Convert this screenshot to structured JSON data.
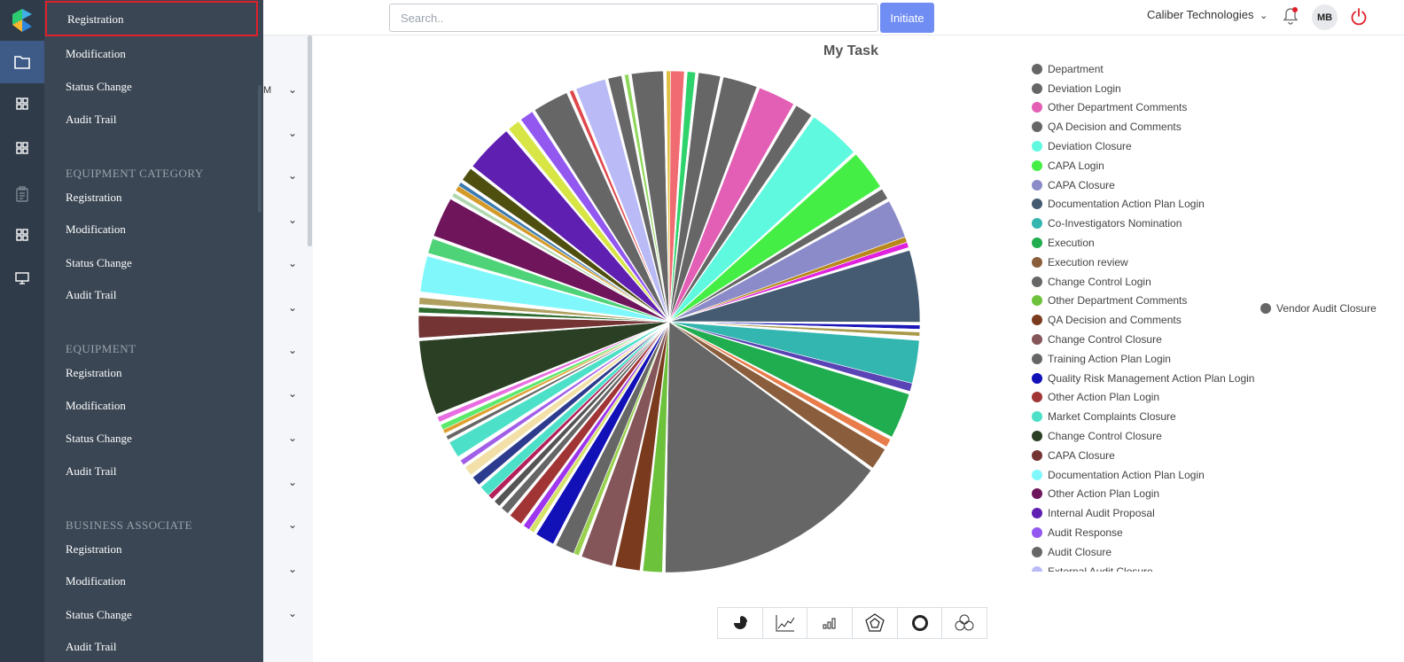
{
  "sidebar": {
    "top_items": [
      {
        "label": "Registration"
      },
      {
        "label": "Modification"
      },
      {
        "label": "Status  Change"
      },
      {
        "label": "Audit  Trail"
      }
    ],
    "sections": [
      {
        "title": "EQUIPMENT  CATEGORY",
        "items": [
          {
            "label": "Registration"
          },
          {
            "label": "Modification"
          },
          {
            "label": "Status  Change"
          },
          {
            "label": "Audit  Trail"
          }
        ]
      },
      {
        "title": "EQUIPMENT",
        "items": [
          {
            "label": "Registration"
          },
          {
            "label": "Modification"
          },
          {
            "label": "Status  Change"
          },
          {
            "label": "Audit  Trail"
          }
        ]
      },
      {
        "title": "BUSINESS  ASSOCIATE",
        "items": [
          {
            "label": "Registration"
          },
          {
            "label": "Modification"
          },
          {
            "label": "Status  Change"
          },
          {
            "label": "Audit  Trail"
          }
        ]
      }
    ]
  },
  "strip": {
    "partial_text": "M"
  },
  "header": {
    "search_placeholder": "Search..",
    "initiate_label": "Initiate",
    "company": "Caliber Technologies",
    "avatar_initials": "MB"
  },
  "colors": {
    "accent": "#6f8df3",
    "rail": "#2f3b48",
    "panel": "#3a4654",
    "power": "#e0202a"
  },
  "chart_data": {
    "type": "pie",
    "title": "My Task",
    "legend_visible": [
      {
        "name": "Department",
        "color": "#666666"
      },
      {
        "name": "Deviation Login",
        "color": "#666666"
      },
      {
        "name": "Other Department Comments",
        "color": "#e35eb5"
      },
      {
        "name": "QA Decision and Comments",
        "color": "#666666"
      },
      {
        "name": "Deviation Closure",
        "color": "#5ff9e0"
      },
      {
        "name": "CAPA Login",
        "color": "#45ee45"
      },
      {
        "name": "CAPA Closure",
        "color": "#8b8bc9"
      },
      {
        "name": "Documentation Action Plan Login",
        "color": "#445b72"
      },
      {
        "name": "Co-Investigators Nomination",
        "color": "#33b6b0"
      },
      {
        "name": "Execution",
        "color": "#1fad4f"
      },
      {
        "name": "Execution review",
        "color": "#8a5e3c"
      },
      {
        "name": "Change Control Login",
        "color": "#666666"
      },
      {
        "name": "Other Department Comments",
        "color": "#6cc23a"
      },
      {
        "name": "QA Decision and Comments",
        "color": "#7a3a1d"
      },
      {
        "name": "Change Control Closure",
        "color": "#845559"
      },
      {
        "name": "Training Action Plan Login",
        "color": "#666666"
      },
      {
        "name": "Quality Risk Management Action Plan Login",
        "color": "#1210b7"
      },
      {
        "name": "Other Action Plan Login",
        "color": "#a13535"
      },
      {
        "name": "Market Complaints Closure",
        "color": "#4de0c8"
      },
      {
        "name": "Change Control Closure",
        "color": "#2a3f23"
      },
      {
        "name": "CAPA Closure",
        "color": "#753434"
      },
      {
        "name": "Documentation Action Plan Login",
        "color": "#80f8fb"
      },
      {
        "name": "Other Action Plan Login",
        "color": "#6e155c"
      },
      {
        "name": "Internal Audit Proposal",
        "color": "#5f1fb0"
      },
      {
        "name": "Audit Response",
        "color": "#9258ef"
      },
      {
        "name": "Audit Closure",
        "color": "#666666"
      },
      {
        "name": "External Audit Closure",
        "color": "#b9baf6"
      }
    ],
    "legend_page2": [
      {
        "name": "Vendor Audit Closure",
        "color": "#666666"
      }
    ],
    "slices": [
      {
        "color": "#f16b72",
        "value": 1.0
      },
      {
        "color": "#ffffff",
        "value": 0.2
      },
      {
        "color": "#2fd36b",
        "value": 0.6
      },
      {
        "color": "#ffffff",
        "value": 0.2
      },
      {
        "color": "#666666",
        "value": 1.6
      },
      {
        "color": "#ffffff",
        "value": 0.2
      },
      {
        "color": "#666666",
        "value": 2.5
      },
      {
        "color": "#ffffff",
        "value": 0.2
      },
      {
        "color": "#e35eb5",
        "value": 2.7
      },
      {
        "color": "#ffffff",
        "value": 0.2
      },
      {
        "color": "#666666",
        "value": 1.3
      },
      {
        "color": "#ffffff",
        "value": 0.2
      },
      {
        "color": "#5ff9e0",
        "value": 3.8
      },
      {
        "color": "#ffffff",
        "value": 0.2
      },
      {
        "color": "#45ee45",
        "value": 2.9
      },
      {
        "color": "#ffffff",
        "value": 0.2
      },
      {
        "color": "#666666",
        "value": 0.8
      },
      {
        "color": "#ffffff",
        "value": 0.2
      },
      {
        "color": "#8b8bc9",
        "value": 2.8
      },
      {
        "color": "#b8891a",
        "value": 0.4
      },
      {
        "color": "#e021e0",
        "value": 0.4
      },
      {
        "color": "#ffffff",
        "value": 0.2
      },
      {
        "color": "#445b72",
        "value": 5.2
      },
      {
        "color": "#ffffff",
        "value": 0.2
      },
      {
        "color": "#1a16b8",
        "value": 0.3
      },
      {
        "color": "#ffffff",
        "value": 0.2
      },
      {
        "color": "#a99a4a",
        "value": 0.3
      },
      {
        "color": "#ffffff",
        "value": 0.3
      },
      {
        "color": "#33b6b0",
        "value": 3.1
      },
      {
        "color": "#5a43b5",
        "value": 0.6
      },
      {
        "color": "#ffffff",
        "value": 0.2
      },
      {
        "color": "#1fad4f",
        "value": 3.3
      },
      {
        "color": "#ffffff",
        "value": 0.2
      },
      {
        "color": "#e87c4a",
        "value": 0.6
      },
      {
        "color": "#ffffff",
        "value": 0.2
      },
      {
        "color": "#8a5e3c",
        "value": 1.6
      },
      {
        "color": "#ffffff",
        "value": 0.2
      },
      {
        "color": "#666666",
        "value": 17.0
      },
      {
        "color": "#ffffff",
        "value": 0.2
      },
      {
        "color": "#6cc23a",
        "value": 1.4
      },
      {
        "color": "#ffffff",
        "value": 0.2
      },
      {
        "color": "#7a3a1d",
        "value": 1.8
      },
      {
        "color": "#ffffff",
        "value": 0.2
      },
      {
        "color": "#845559",
        "value": 2.3
      },
      {
        "color": "#ffffff",
        "value": 0.2
      },
      {
        "color": "#9ad24f",
        "value": 0.4
      },
      {
        "color": "#666666",
        "value": 1.4
      },
      {
        "color": "#ffffff",
        "value": 0.2
      },
      {
        "color": "#1210b7",
        "value": 1.4
      },
      {
        "color": "#ffffff",
        "value": 0.2
      },
      {
        "color": "#d7e26a",
        "value": 0.4
      },
      {
        "color": "#9d36ee",
        "value": 0.5
      },
      {
        "color": "#ffffff",
        "value": 0.2
      },
      {
        "color": "#a13535",
        "value": 1.0
      },
      {
        "color": "#ffffff",
        "value": 0.2
      },
      {
        "color": "#666666",
        "value": 0.6
      },
      {
        "color": "#ffffff",
        "value": 0.2
      },
      {
        "color": "#555555",
        "value": 0.5
      },
      {
        "color": "#ffffff",
        "value": 0.2
      },
      {
        "color": "#b3215b",
        "value": 0.4
      },
      {
        "color": "#4de0c8",
        "value": 0.8
      },
      {
        "color": "#ffffff",
        "value": 0.2
      },
      {
        "color": "#2d3b8e",
        "value": 0.7
      },
      {
        "color": "#ffffff",
        "value": 0.2
      },
      {
        "color": "#f2e0a8",
        "value": 0.7
      },
      {
        "color": "#ffffff",
        "value": 0.2
      },
      {
        "color": "#a15fe8",
        "value": 0.4
      },
      {
        "color": "#ffffff",
        "value": 0.3
      },
      {
        "color": "#4de0c8",
        "value": 1.2
      },
      {
        "color": "#ffffff",
        "value": 0.2
      },
      {
        "color": "#666666",
        "value": 0.3
      },
      {
        "color": "#ffffff",
        "value": 0.2
      },
      {
        "color": "#e0a030",
        "value": 0.3
      },
      {
        "color": "#5bea6b",
        "value": 0.4
      },
      {
        "color": "#ffffff",
        "value": 0.2
      },
      {
        "color": "#e76de0",
        "value": 0.4
      },
      {
        "color": "#ffffff",
        "value": 0.2
      },
      {
        "color": "#2a3f23",
        "value": 5.4
      },
      {
        "color": "#ffffff",
        "value": 0.2
      },
      {
        "color": "#753434",
        "value": 1.6
      },
      {
        "color": "#ffffff",
        "value": 0.2
      },
      {
        "color": "#2e6b2e",
        "value": 0.4
      },
      {
        "color": "#ffffff",
        "value": 0.2
      },
      {
        "color": "#b0a060",
        "value": 0.5
      },
      {
        "color": "#ffffff",
        "value": 0.4
      },
      {
        "color": "#80f8fb",
        "value": 2.6
      },
      {
        "color": "#ffffff",
        "value": 0.2
      },
      {
        "color": "#4fd378",
        "value": 1.1
      },
      {
        "color": "#ffffff",
        "value": 0.2
      },
      {
        "color": "#6e155c",
        "value": 2.9
      },
      {
        "color": "#ffffff",
        "value": 0.2
      },
      {
        "color": "#b0d8b0",
        "value": 0.3
      },
      {
        "color": "#ffffff",
        "value": 0.2
      },
      {
        "color": "#d49a2a",
        "value": 0.4
      },
      {
        "color": "#3a7ab0",
        "value": 0.3
      },
      {
        "color": "#ffffff",
        "value": 0.2
      },
      {
        "color": "#4f4f10",
        "value": 1.0
      },
      {
        "color": "#ffffff",
        "value": 0.2
      },
      {
        "color": "#5f1fb0",
        "value": 3.5
      },
      {
        "color": "#ffffff",
        "value": 0.2
      },
      {
        "color": "#d7e545",
        "value": 0.9
      },
      {
        "color": "#ffffff",
        "value": 0.2
      },
      {
        "color": "#9258ef",
        "value": 1.0
      },
      {
        "color": "#ffffff",
        "value": 0.2
      },
      {
        "color": "#666666",
        "value": 2.6
      },
      {
        "color": "#ffffff",
        "value": 0.2
      },
      {
        "color": "#e0464a",
        "value": 0.3
      },
      {
        "color": "#ffffff",
        "value": 0.2
      },
      {
        "color": "#b9baf6",
        "value": 2.2
      },
      {
        "color": "#ffffff",
        "value": 0.2
      },
      {
        "color": "#666666",
        "value": 1.0
      },
      {
        "color": "#ffffff",
        "value": 0.2
      },
      {
        "color": "#8fd75a",
        "value": 0.3
      },
      {
        "color": "#ffffff",
        "value": 0.2
      },
      {
        "color": "#666666",
        "value": 2.3
      },
      {
        "color": "#ffffff",
        "value": 0.2
      },
      {
        "color": "#e0c040",
        "value": 0.3
      }
    ]
  },
  "chart_types": [
    {
      "icon": "pie-chart-icon"
    },
    {
      "icon": "line-chart-icon"
    },
    {
      "icon": "bar-chart-icon"
    },
    {
      "icon": "polar-area-icon"
    },
    {
      "icon": "doughnut-icon"
    },
    {
      "icon": "radar-icon"
    }
  ]
}
